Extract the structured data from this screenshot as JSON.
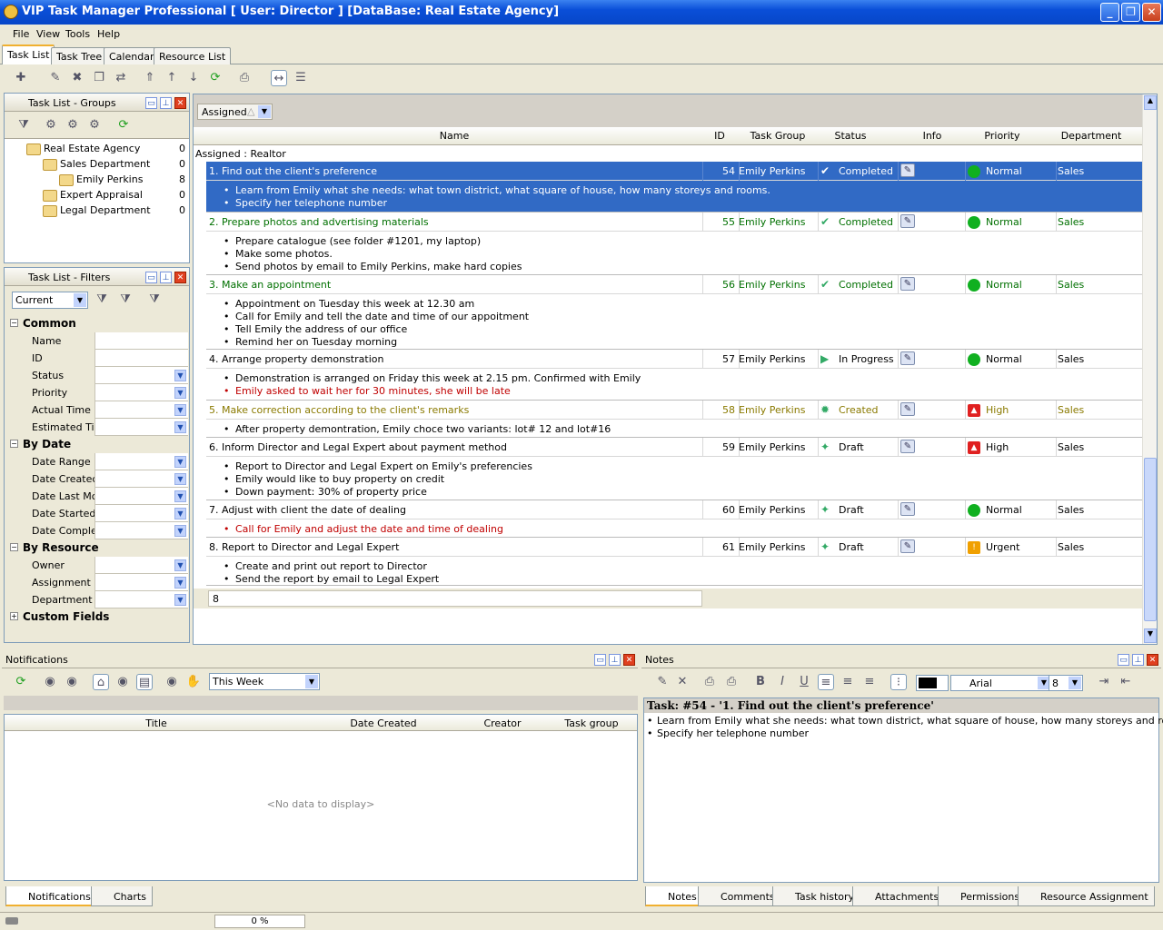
{
  "window": {
    "title": "VIP Task Manager Professional [ User: Director ] [DataBase: Real Estate Agency]",
    "min": "_",
    "max": "❐",
    "close": "✕"
  },
  "menu": [
    "File",
    "View",
    "Tools",
    "Help"
  ],
  "main_tabs": [
    "Task List",
    "Task Tree",
    "Calendar",
    "Resource List"
  ],
  "groups_panel": {
    "title": "Task List - Groups",
    "tree": [
      {
        "label": "Real Estate Agency",
        "count": "0"
      },
      {
        "label": "Sales Department",
        "count": "0"
      },
      {
        "label": "Emily Perkins",
        "count": "8"
      },
      {
        "label": "Expert Appraisal",
        "count": "0"
      },
      {
        "label": "Legal Department",
        "count": "0"
      }
    ]
  },
  "filters_panel": {
    "title": "Task List - Filters",
    "current": "Current",
    "categories": [
      {
        "name": "Common",
        "items": [
          "Name",
          "ID",
          "Status",
          "Priority",
          "Actual Time",
          "Estimated Tir"
        ]
      },
      {
        "name": "By Date",
        "items": [
          "Date Range",
          "Date Createc",
          "Date Last Mc",
          "Date Started",
          "Date Comple"
        ]
      },
      {
        "name": "By Resource",
        "items": [
          "Owner",
          "Assignment",
          "Department"
        ]
      },
      {
        "name": "Custom Fields",
        "items": []
      }
    ]
  },
  "grid": {
    "group_chip": "Assigned",
    "columns": [
      "Name",
      "ID",
      "Task Group",
      "Status",
      "Info",
      "Priority",
      "Department"
    ],
    "group_row": "Assigned : Realtor",
    "tasks": [
      {
        "name": "1. Find out the client's preference",
        "id": "54",
        "group": "Emily Perkins",
        "status": "Completed",
        "priority": "Normal",
        "dept": "Sales",
        "notes": [
          "Learn from Emily what she needs: what town district, what square of house, how many storeys and rooms.",
          "Specify her telephone number"
        ]
      },
      {
        "name": "2. Prepare photos and advertising materials",
        "id": "55",
        "group": "Emily Perkins",
        "status": "Completed",
        "priority": "Normal",
        "dept": "Sales",
        "notes": [
          "Prepare catalogue (see folder #1201, my laptop)",
          "Make some photos.",
          "Send photos by email to Emily Perkins, make hard copies"
        ]
      },
      {
        "name": "3. Make an appointment",
        "id": "56",
        "group": "Emily Perkins",
        "status": "Completed",
        "priority": "Normal",
        "dept": "Sales",
        "notes": [
          "Appointment on Tuesday this week at 12.30 am",
          "Call for Emily and tell the date and time of our appoitment",
          "Tell Emily the address of our office",
          "Remind her on Tuesday morning"
        ]
      },
      {
        "name": "4. Arrange property demonstration",
        "id": "57",
        "group": "Emily Perkins",
        "status": "In Progress",
        "priority": "Normal",
        "dept": "Sales",
        "notes": [
          "Demonstration is arranged on Friday this week at 2.15 pm. Confirmed with Emily",
          "Emily asked to wait her for 30 minutes, she will be late"
        ]
      },
      {
        "name": "5. Make correction according to the client's remarks",
        "id": "58",
        "group": "Emily Perkins",
        "status": "Created",
        "priority": "High",
        "dept": "Sales",
        "notes": [
          "After property demontration, Emily choce two variants: lot# 12 and lot#16"
        ]
      },
      {
        "name": "6. Inform Director and Legal Expert about payment method",
        "id": "59",
        "group": "Emily Perkins",
        "status": "Draft",
        "priority": "High",
        "dept": "Sales",
        "notes": [
          "Report to Director and Legal Expert on Emily's preferencies",
          "Emily would like to buy property on credit",
          "Down payment: 30% of property price"
        ]
      },
      {
        "name": "7. Adjust with client the date of dealing",
        "id": "60",
        "group": "Emily Perkins",
        "status": "Draft",
        "priority": "Normal",
        "dept": "Sales",
        "notes": [
          "Call for Emily and adjust the date and time of dealing"
        ]
      },
      {
        "name": "8. Report to Director and Legal Expert",
        "id": "61",
        "group": "Emily Perkins",
        "status": "Draft",
        "priority": "Urgent",
        "dept": "Sales",
        "notes": [
          "Create and print out report to Director",
          "Send the report by email to Legal Expert"
        ]
      }
    ],
    "footer_count": "8"
  },
  "notifications": {
    "title": "Notifications",
    "period": "This Week",
    "columns": [
      "Title",
      "Date Created",
      "Creator",
      "Task group"
    ],
    "empty": "<No data to display>",
    "tabs": [
      "Notifications",
      "Charts"
    ]
  },
  "notes": {
    "title": "Notes",
    "font": "Arial",
    "size": "8",
    "heading": "Task: #54 - '1. Find out the client's preference'",
    "lines": [
      "Learn from Emily what she needs: what town district, what square of house, how many storeys and rooms.",
      "Specify her telephone number"
    ],
    "tabs": [
      "Notes",
      "Comments",
      "Task history",
      "Attachments",
      "Permissions",
      "Resource Assignment"
    ]
  },
  "status": {
    "progress": "0 %"
  },
  "colors": {
    "completed": "#007000",
    "created": "#8a7a00",
    "late": "#c00000",
    "selected": "#316ac5"
  }
}
